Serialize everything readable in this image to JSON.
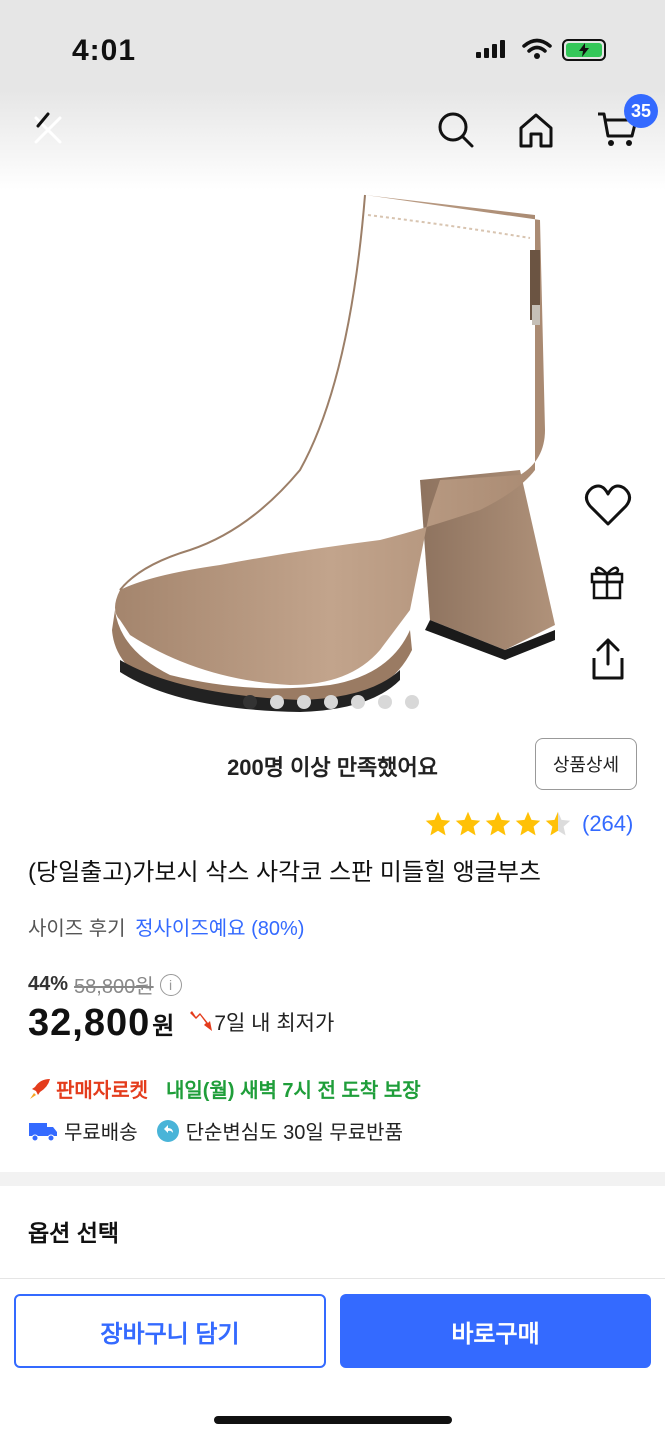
{
  "status_bar": {
    "time": "4:01",
    "battery_color": "#34c759"
  },
  "nav": {
    "back_icon": "back-close-icon",
    "search_icon": "search-icon",
    "home_icon": "home-icon",
    "cart_icon": "cart-icon",
    "cart_count": "35"
  },
  "gallery": {
    "image_count": 7,
    "active_index": 0,
    "product_color": "#b99a80"
  },
  "side_actions": [
    "heart-icon",
    "gift-icon",
    "share-icon"
  ],
  "satisfaction": {
    "count": "200명",
    "text": " 이상 만족했어요"
  },
  "detail_button": "상품상세",
  "rating": {
    "stars": 4.5,
    "review_count": "(264)"
  },
  "product_title": "(당일출고)가보시 삭스 사각코 스판 미들힐 앵글부츠",
  "size_review": {
    "label": "사이즈 후기",
    "value": "정사이즈예요 (80%)"
  },
  "price": {
    "discount": "44%",
    "original": "58,800원",
    "current": "32,800",
    "currency": "원",
    "lowest_badge": "7일 내 최저가"
  },
  "shipping": {
    "rocket_label": "판매자로켓",
    "delivery": "내일(월) 새벽 7시 전 도착 보장",
    "free_shipping": "무료배송",
    "free_return": "단순변심도 30일 무료반품"
  },
  "options": {
    "title": "옵션 선택"
  },
  "bottom": {
    "cart_button": "장바구니 담기",
    "buy_button": "바로구매"
  },
  "colors": {
    "accent": "#346aff",
    "rocket": "#e43c1c",
    "delivery": "#1f9e3a",
    "star": "#ffc107"
  }
}
